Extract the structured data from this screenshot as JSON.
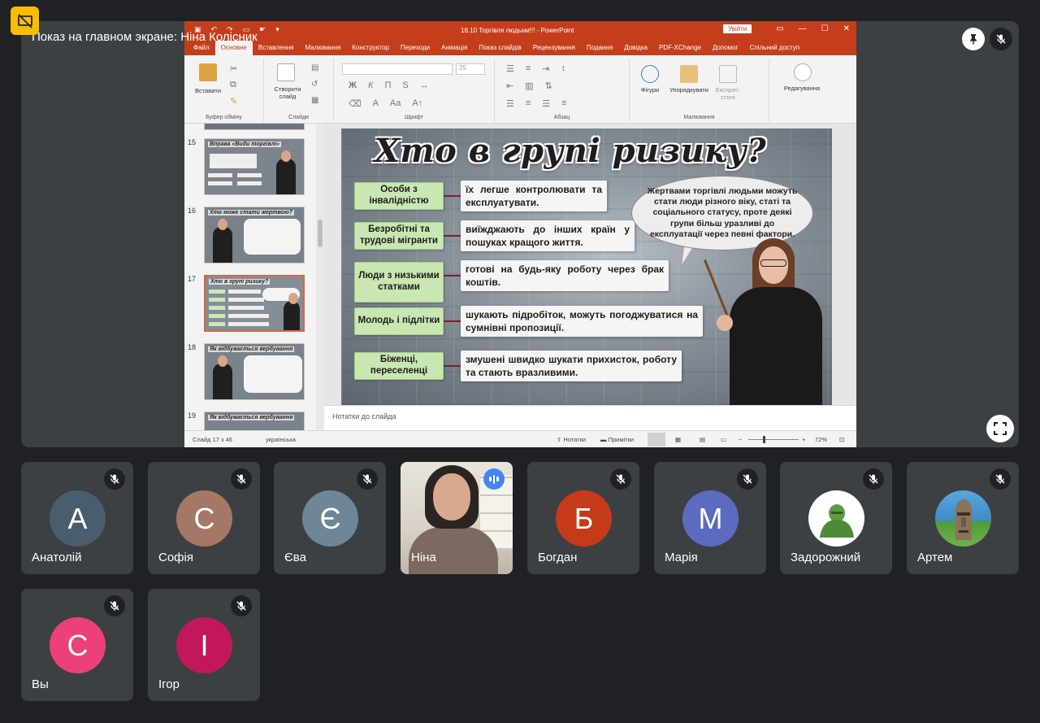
{
  "meet": {
    "presenting_label": "Показ на главном экране: Ніна Колісник"
  },
  "ppt": {
    "doc_title": "18.10 Торгівля людьми!!! - PowerPoint",
    "signin": "Увійти",
    "tabs": [
      "Файл",
      "Основне",
      "Вставлення",
      "Малювання",
      "Конструктор",
      "Переходи",
      "Анімація",
      "Показ слайдів",
      "Рецензування",
      "Подання",
      "Довідка",
      "PDF-XChange",
      "Допомог",
      "Спільний доступ"
    ],
    "ribbon": {
      "paste": "Вставити",
      "clipboard": "Буфер обміну",
      "new_slide": "Створити слайд",
      "slides": "Слайди",
      "font": "Шрифт",
      "font_size": "25",
      "paragraph": "Абзац",
      "shapes": "Фігури",
      "arrange": "Упорядкувати",
      "express_styles": "Експрес-стилі",
      "drawing": "Малювання",
      "editing": "Редагування"
    },
    "thumbnails": [
      {
        "num": "15",
        "title": "Вправа «Види торгівлі»"
      },
      {
        "num": "16",
        "title": "Хто може стати жертвою?"
      },
      {
        "num": "17",
        "title": "Хто в групі ризику?"
      },
      {
        "num": "18",
        "title": "Як відбувається вербування"
      },
      {
        "num": "19",
        "title": "Як відбувається вербування"
      }
    ],
    "slide": {
      "title": "Хто в групі ризику?",
      "speech": "Жертвами торгівлі людьми можуть стати люди різного віку, статі та соціального статусу, проте деякі групи більш уразливі до експлуатації через певні фактори.",
      "rows": [
        {
          "category": "Особи з інвалідністю",
          "description": "їх легше контролювати та експлуатувати."
        },
        {
          "category": "Безробітні та трудові мігранти",
          "description": "виїжджають до інших країн у пошуках кращого життя."
        },
        {
          "category": "Люди з низькими статками",
          "description": "готові на будь-яку роботу через брак коштів."
        },
        {
          "category": "Молодь і підлітки",
          "description": "шукають підробіток, можуть погоджуватися на сумнівні пропозиції."
        },
        {
          "category": "Біженці, переселенці",
          "description": "змушені швидко шукати прихисток, роботу та стають вразливими."
        }
      ]
    },
    "notes_placeholder": "Нотатки до слайда",
    "status": {
      "slide_count": "Слайд 17 з 46",
      "language": "українська",
      "notes_btn": "Нотатки",
      "comments_btn": "Примітки",
      "zoom": "72%"
    }
  },
  "participants": [
    {
      "name": "Анатолій",
      "initial": "А",
      "color": "#4a5d6c"
    },
    {
      "name": "Софія",
      "initial": "С",
      "color": "#a57766"
    },
    {
      "name": "Єва",
      "initial": "Є",
      "color": "#6e8696"
    },
    {
      "name": "Ніна",
      "initial": "",
      "color": ""
    },
    {
      "name": "Богдан",
      "initial": "Б",
      "color": "#c53a18"
    },
    {
      "name": "Марія",
      "initial": "М",
      "color": "#5c6bc0"
    },
    {
      "name": "Задорожний",
      "initial": "",
      "color": "#ffffff"
    },
    {
      "name": "Артем",
      "initial": "",
      "color": "#3f8bc4"
    },
    {
      "name": "Вы",
      "initial": "С",
      "color": "#ec407a"
    },
    {
      "name": "Ігор",
      "initial": "І",
      "color": "#c2185b"
    }
  ]
}
